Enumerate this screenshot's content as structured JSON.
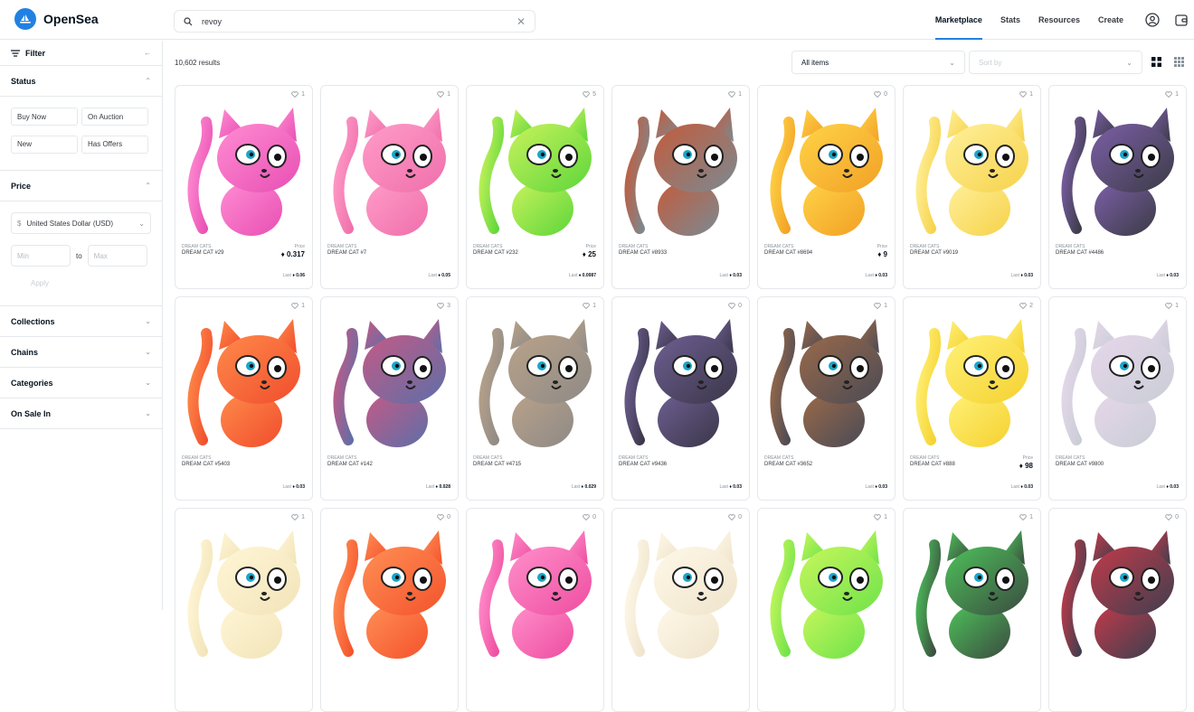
{
  "app": {
    "logo_text": "OpenSea"
  },
  "search": {
    "value": "revoy"
  },
  "nav": {
    "links": [
      "Marketplace",
      "Stats",
      "Resources",
      "Create"
    ]
  },
  "sidebar": {
    "filter_label": "Filter",
    "status_label": "Status",
    "status_buttons": [
      "Buy Now",
      "On Auction",
      "New",
      "Has Offers"
    ],
    "price_label": "Price",
    "currency": "United States Dollar (USD)",
    "currency_symbol": "$",
    "min_placeholder": "Min",
    "to_label": "to",
    "max_placeholder": "Max",
    "apply_label": "Apply",
    "sections": [
      "Collections",
      "Chains",
      "Categories",
      "On Sale In"
    ]
  },
  "main": {
    "results": "10,602 results",
    "items_select": "All items",
    "sort_placeholder": "Sort by"
  },
  "cards": [
    {
      "collection": "DREAM CATS",
      "name": "DREAM CAT #29",
      "favs": "1",
      "price_label": "Price",
      "price": "0.317",
      "last_label": "Last",
      "last": "0.06",
      "colors": [
        "#e84fb3",
        "#ff8cd3"
      ]
    },
    {
      "collection": "DREAM CATS",
      "name": "DREAM CAT #7",
      "favs": "1",
      "price_label": "",
      "price": "",
      "last_label": "Last",
      "last": "0.05",
      "colors": [
        "#ef6fab",
        "#ff9cc8"
      ]
    },
    {
      "collection": "DREAM CATS",
      "name": "DREAM CAT #232",
      "favs": "5",
      "price_label": "Price",
      "price": "25",
      "last_label": "Last",
      "last": "0.0087",
      "colors": [
        "#5dd63a",
        "#c8f25c"
      ]
    },
    {
      "collection": "DREAM CATS",
      "name": "DREAM CAT #8933",
      "favs": "1",
      "price_label": "",
      "price": "",
      "last_label": "Last",
      "last": "0.03",
      "colors": [
        "#7a8a93",
        "#c45b3b"
      ]
    },
    {
      "collection": "DREAM CATS",
      "name": "DREAM CAT #8694",
      "favs": "0",
      "price_label": "Price",
      "price": "9",
      "last_label": "Last",
      "last": "0.03",
      "colors": [
        "#f2a025",
        "#ffd347"
      ]
    },
    {
      "collection": "DREAM CATS",
      "name": "DREAM CAT #9019",
      "favs": "1",
      "price_label": "",
      "price": "",
      "last_label": "Last",
      "last": "0.03",
      "colors": [
        "#f6d24a",
        "#fff09a"
      ]
    },
    {
      "collection": "DREAM CATS",
      "name": "DREAM CAT #4486",
      "favs": "1",
      "price_label": "",
      "price": "",
      "last_label": "Last",
      "last": "0.03",
      "colors": [
        "#3b3b45",
        "#7c5fa8"
      ]
    },
    {
      "collection": "DREAM CATS",
      "name": "DREAM CAT #5403",
      "favs": "1",
      "price_label": "",
      "price": "",
      "last_label": "Last",
      "last": "0.03",
      "colors": [
        "#f04d2d",
        "#ff8a4a"
      ]
    },
    {
      "collection": "DREAM CATS",
      "name": "DREAM CAT #142",
      "favs": "3",
      "price_label": "",
      "price": "",
      "last_label": "Last",
      "last": "0.028",
      "colors": [
        "#5c6fa8",
        "#c45a86"
      ]
    },
    {
      "collection": "DREAM CATS",
      "name": "DREAM CAT #4715",
      "favs": "1",
      "price_label": "",
      "price": "",
      "last_label": "Last",
      "last": "0.029",
      "colors": [
        "#8e8a86",
        "#b9a28a"
      ]
    },
    {
      "collection": "DREAM CATS",
      "name": "DREAM CAT #9436",
      "favs": "0",
      "price_label": "",
      "price": "",
      "last_label": "Last",
      "last": "0.03",
      "colors": [
        "#3b3648",
        "#6d5f92"
      ]
    },
    {
      "collection": "DREAM CATS",
      "name": "DREAM CAT #3652",
      "favs": "1",
      "price_label": "",
      "price": "",
      "last_label": "Last",
      "last": "0.03",
      "colors": [
        "#4a4a55",
        "#9a6a4a"
      ]
    },
    {
      "collection": "DREAM CATS",
      "name": "DREAM CAT #888",
      "favs": "2",
      "price_label": "Price",
      "price": "98",
      "last_label": "Last",
      "last": "0.03",
      "colors": [
        "#f5d130",
        "#fff177"
      ]
    },
    {
      "collection": "DREAM CATS",
      "name": "DREAM CAT #9800",
      "favs": "1",
      "price_label": "",
      "price": "",
      "last_label": "Last",
      "last": "0.03",
      "colors": [
        "#c9cdd6",
        "#e6d7ea"
      ]
    },
    {
      "collection": "",
      "name": "",
      "favs": "1",
      "price_label": "",
      "price": "",
      "last_label": "",
      "last": "",
      "colors": [
        "#f2e4b9",
        "#fff6d6"
      ]
    },
    {
      "collection": "",
      "name": "",
      "favs": "0",
      "price_label": "",
      "price": "",
      "last_label": "",
      "last": "",
      "colors": [
        "#f4522b",
        "#ff8f55"
      ]
    },
    {
      "collection": "",
      "name": "",
      "favs": "0",
      "price_label": "",
      "price": "",
      "last_label": "",
      "last": "",
      "colors": [
        "#ee4da0",
        "#ff8fcb"
      ]
    },
    {
      "collection": "",
      "name": "",
      "favs": "0",
      "price_label": "",
      "price": "",
      "last_label": "",
      "last": "",
      "colors": [
        "#efe4cc",
        "#fff8e8"
      ]
    },
    {
      "collection": "",
      "name": "",
      "favs": "1",
      "price_label": "",
      "price": "",
      "last_label": "",
      "last": "",
      "colors": [
        "#6fe24a",
        "#c6f75c"
      ]
    },
    {
      "collection": "",
      "name": "",
      "favs": "1",
      "price_label": "",
      "price": "",
      "last_label": "",
      "last": "",
      "colors": [
        "#3b4a40",
        "#4dc15a"
      ]
    },
    {
      "collection": "",
      "name": "",
      "favs": "0",
      "price_label": "",
      "price": "",
      "last_label": "",
      "last": "",
      "colors": [
        "#3d3f4f",
        "#c23a4a"
      ]
    }
  ],
  "colors": {
    "accent": "#2081e2",
    "border": "#e5e8eb",
    "text": "#04111d"
  },
  "icons": [
    "search-icon",
    "close-icon",
    "profile-icon",
    "wallet-icon",
    "filter-icon",
    "arrow-left-icon",
    "chevron-down-icon",
    "heart-icon",
    "eth-icon",
    "grid-view-icon",
    "compact-view-icon"
  ]
}
